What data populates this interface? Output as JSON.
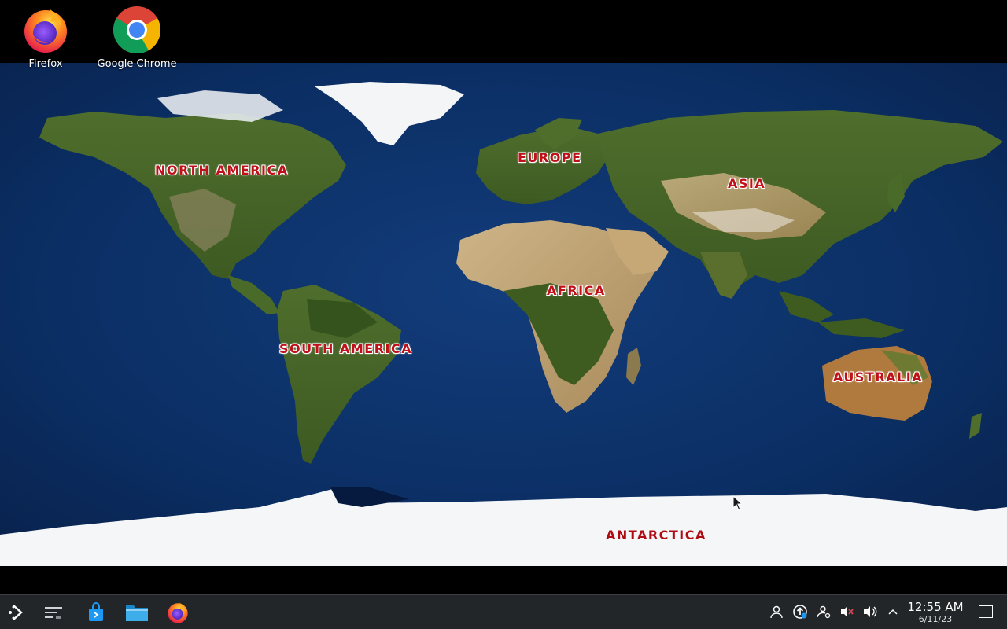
{
  "desktop": {
    "icons": [
      {
        "label": "Firefox",
        "icon": "firefox-icon"
      },
      {
        "label": "Google Chrome",
        "icon": "chrome-icon"
      }
    ]
  },
  "wallpaper": {
    "labels": {
      "north_america": "NORTH AMERICA",
      "europe": "EUROPE",
      "asia": "ASIA",
      "africa": "AFRICA",
      "south_america": "SOUTH AMERICA",
      "australia": "AUSTRALIA",
      "antarctica": "ANTARCTICA"
    },
    "label_color": "#c0101a",
    "ocean_color": "#0b2a5c",
    "land_color": "#6b7a3a",
    "ice_color": "#f4f6f8"
  },
  "taskbar": {
    "launchers": [
      {
        "name": "application-launcher",
        "icon": "kde-launcher-icon"
      },
      {
        "name": "pager",
        "icon": "virtual-desktops-icon"
      },
      {
        "name": "discover",
        "icon": "store-bag-icon"
      },
      {
        "name": "dolphin",
        "icon": "folder-icon"
      },
      {
        "name": "firefox",
        "icon": "firefox-icon"
      }
    ],
    "tray": [
      {
        "name": "user",
        "icon": "user-icon"
      },
      {
        "name": "updates",
        "icon": "update-icon"
      },
      {
        "name": "kde-connect",
        "icon": "person-settings-icon"
      },
      {
        "name": "microphone-muted",
        "icon": "mic-muted-icon"
      },
      {
        "name": "volume",
        "icon": "speaker-icon"
      },
      {
        "name": "expand-tray",
        "icon": "chevron-up-icon"
      }
    ],
    "clock": {
      "time": "12:55 AM",
      "date": "6/11/23"
    },
    "background": "#232629"
  }
}
